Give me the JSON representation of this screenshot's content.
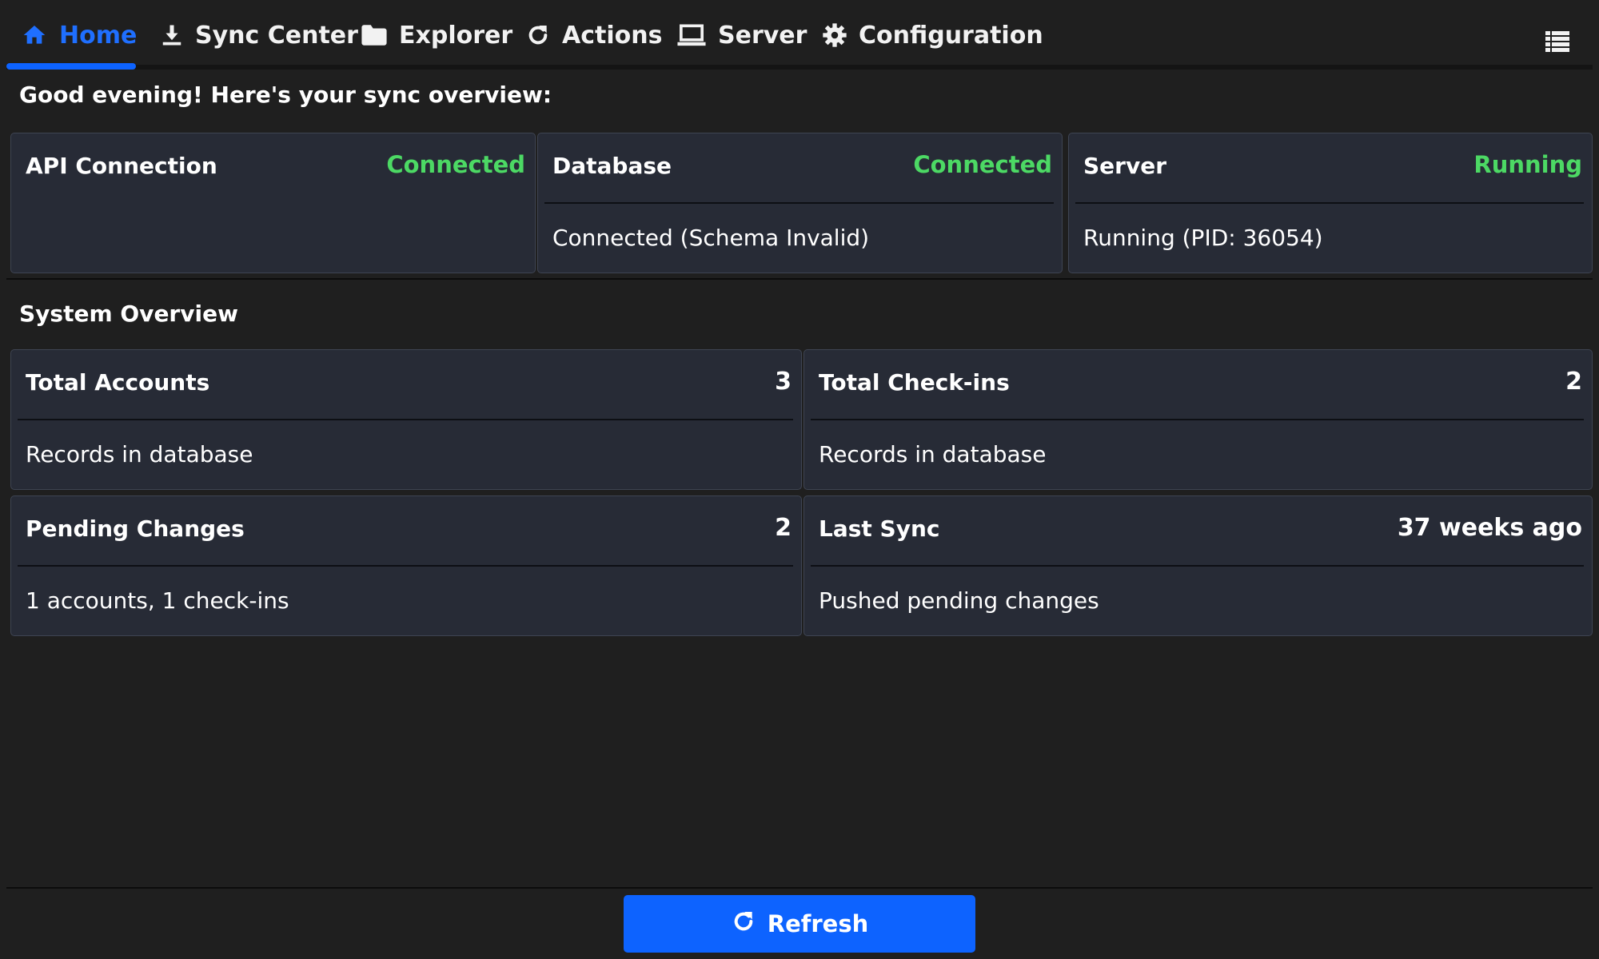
{
  "nav": {
    "tabs": [
      {
        "label": "Home",
        "icon": "home-icon",
        "active": true
      },
      {
        "label": "Sync Center",
        "icon": "download-icon"
      },
      {
        "label": "Explorer",
        "icon": "folder-icon"
      },
      {
        "label": "Actions",
        "icon": "refresh-icon"
      },
      {
        "label": "Server",
        "icon": "laptop-icon"
      },
      {
        "label": "Configuration",
        "icon": "gear-icon"
      }
    ],
    "menu_icon": "list-icon"
  },
  "greeting": "Good evening! Here's your sync overview:",
  "status_cards": [
    {
      "title": "API Connection",
      "status": "Connected",
      "detail": ""
    },
    {
      "title": "Database",
      "status": "Connected",
      "detail": "Connected (Schema Invalid)"
    },
    {
      "title": "Server",
      "status": "Running",
      "detail": "Running (PID: 36054)"
    }
  ],
  "system_overview": {
    "title": "System Overview",
    "cards": [
      {
        "title": "Total Accounts",
        "value": "3",
        "detail": "Records in database"
      },
      {
        "title": "Total Check-ins",
        "value": "2",
        "detail": "Records in database"
      },
      {
        "title": "Pending Changes",
        "value": "2",
        "detail": "1 accounts, 1 check-ins"
      },
      {
        "title": "Last Sync",
        "value": "37 weeks ago",
        "detail": "Pushed pending changes"
      }
    ]
  },
  "footer": {
    "refresh_label": "Refresh",
    "refresh_icon": "refresh-icon"
  },
  "colors": {
    "accent": "#0d63ff",
    "status_ok": "#4cd964",
    "background": "#1f1f1f",
    "card": "#272b36"
  }
}
